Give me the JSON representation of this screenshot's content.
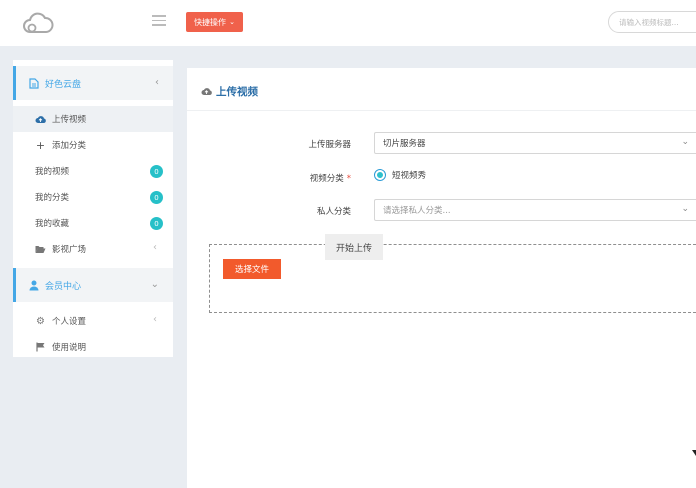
{
  "header": {
    "quick_action_label": "快捷操作",
    "search_placeholder": "请输入视频标题..."
  },
  "sidebar": {
    "groups": [
      {
        "label": "好色云盘",
        "items": [
          {
            "label": "上传视频"
          },
          {
            "label": "添加分类"
          },
          {
            "label": "我的视频",
            "badge": "0"
          },
          {
            "label": "我的分类",
            "badge": "0"
          },
          {
            "label": "我的收藏",
            "badge": "0"
          },
          {
            "label": "影视广场"
          }
        ]
      },
      {
        "label": "会员中心",
        "items": [
          {
            "label": "个人设置"
          },
          {
            "label": "使用说明"
          }
        ]
      }
    ]
  },
  "main": {
    "title": "上传视频",
    "form": {
      "server_label": "上传服务器",
      "server_value": "切片服务器",
      "category_label": "视频分类",
      "category_required_mark": "*",
      "category_option": "短视频秀",
      "private_label": "私人分类",
      "private_placeholder": "请选择私人分类..."
    },
    "pick_file_label": "选择文件",
    "start_upload_label": "开始上传"
  },
  "colors": {
    "accent_blue": "#44a7e6",
    "orange": "#f25a2c",
    "badge_teal": "#26c0c8"
  }
}
